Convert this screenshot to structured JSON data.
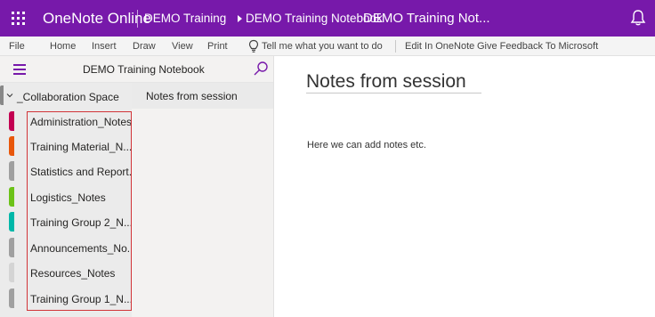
{
  "topbar": {
    "app_name": "OneNote Online",
    "breadcrumb": [
      "DEMO Training",
      "DEMO Training Notebook"
    ],
    "notebook_title": "DEMO Training Not..."
  },
  "menubar": {
    "items": [
      "File",
      "Home",
      "Insert",
      "Draw",
      "View",
      "Print"
    ],
    "tell_me": "Tell me what you want to do",
    "edit_in_onenote": "Edit In OneNote",
    "feedback": "Give Feedback To Microsoft"
  },
  "nav": {
    "notebook_name": "DEMO Training Notebook",
    "section_group": "_Collaboration Space",
    "sections": [
      {
        "label": "Administration_Notes",
        "color": "#c30052"
      },
      {
        "label": "Training Material_N...",
        "color": "#e8570b"
      },
      {
        "label": "Statistics and Report...",
        "color": "#a0a0a0"
      },
      {
        "label": "Logistics_Notes",
        "color": "#6cc218"
      },
      {
        "label": "Training Group 2_N...",
        "color": "#00b7a8"
      },
      {
        "label": "Announcements_No...",
        "color": "#a0a0a0"
      },
      {
        "label": "Resources_Notes",
        "color": "#d4d4d4"
      },
      {
        "label": "Training Group 1_N...",
        "color": "#a0a0a0"
      }
    ],
    "pages": [
      "Notes from session"
    ]
  },
  "canvas": {
    "title": "Notes from session",
    "body": "Here we can add notes etc."
  },
  "colors": {
    "brand": "#7719aa",
    "highlight": "#d13438"
  }
}
